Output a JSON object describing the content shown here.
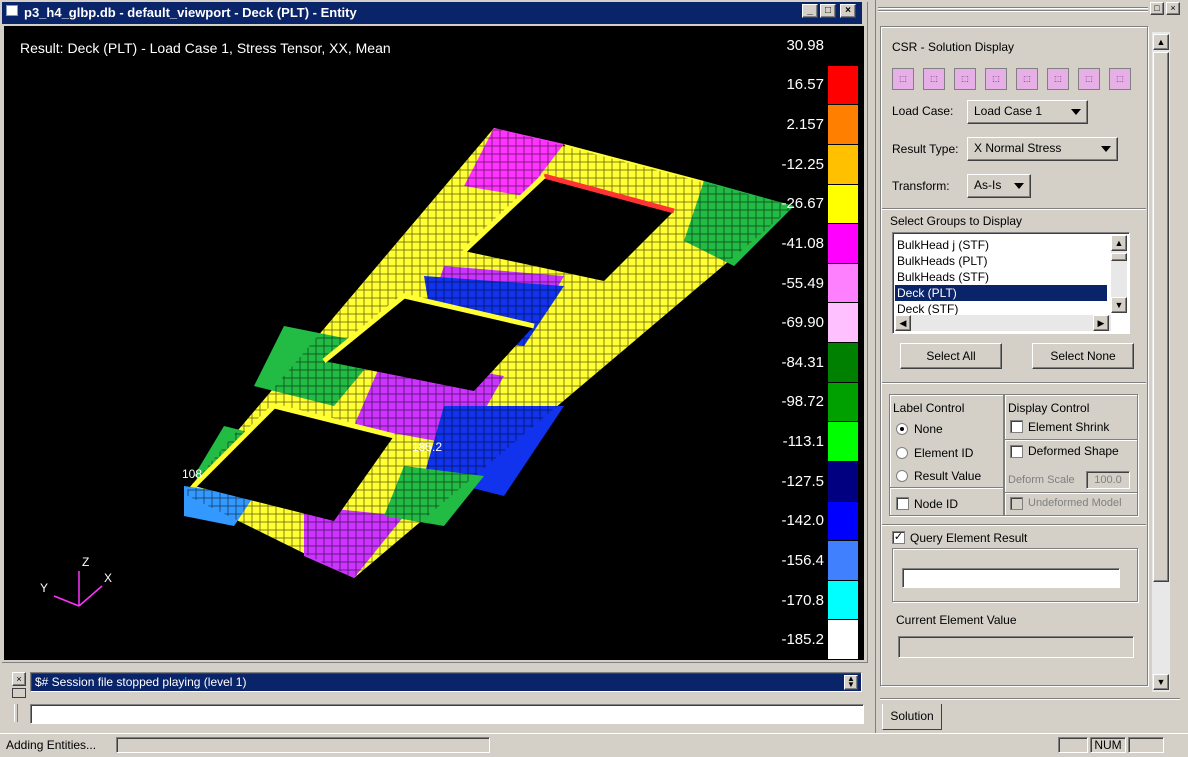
{
  "viewport": {
    "title": "p3_h4_glbp.db - default_viewport - Deck (PLT) - Entity",
    "result_text": "Result: Deck (PLT) - Load Case 1, Stress Tensor, XX, Mean",
    "annot_max": "185.2",
    "annot_min": "108",
    "axis_z": "Z",
    "axis_y": "Y",
    "axis_x": "X",
    "minimize_glyph": "_",
    "maximize_glyph": "□",
    "close_glyph": "×"
  },
  "legend": {
    "labels": [
      "30.98",
      "16.57",
      "2.157",
      "-12.25",
      "-26.67",
      "-41.08",
      "-55.49",
      "-69.90",
      "-84.31",
      "-98.72",
      "-113.1",
      "-127.5",
      "-142.0",
      "-156.4",
      "-170.8",
      "-185.2"
    ],
    "colors": [
      "#000000",
      "#ff0000",
      "#ff8000",
      "#ffc000",
      "#ffff00",
      "#ff00ff",
      "#ff80ff",
      "#ffc0ff",
      "#008000",
      "#00a000",
      "#00ff00",
      "#000080",
      "#0000ff",
      "#4080ff",
      "#00ffff",
      "#ffffff"
    ]
  },
  "panel": {
    "title": "CSR - Solution Display",
    "load_case_label": "Load Case:",
    "load_case_value": "Load Case 1",
    "result_type_label": "Result Type:",
    "result_type_value": "X Normal Stress",
    "transform_label": "Transform:",
    "transform_value": "As-Is",
    "groups_label": "Select Groups to Display",
    "groups": [
      "BulkHead j (STF)",
      "BulkHeads (PLT)",
      "BulkHeads (STF)",
      "Deck (PLT)",
      "Deck (STF)"
    ],
    "selected_group": "Deck (PLT)",
    "select_all": "Select All",
    "select_none": "Select None",
    "label_control": "Label Control",
    "display_control": "Display Control",
    "none": "None",
    "element_id": "Element ID",
    "result_value": "Result Value",
    "node_id": "Node ID",
    "element_shrink": "Element Shrink",
    "deformed_shape": "Deformed Shape",
    "deform_scale": "Deform Scale",
    "deform_scale_value": "100.0",
    "undeformed_model": "Undeformed Model",
    "query_element_result": "Query Element Result",
    "current_element_value": "Current Element Value",
    "tab": "Solution",
    "toolbar_icons": [
      "view-x-icon",
      "view-y-icon",
      "view-z-icon",
      "view-zx-icon",
      "view-iso1-icon",
      "view-iso2-icon",
      "view-iso3-icon",
      "view-iso4-icon"
    ]
  },
  "command": {
    "history": "$# Session file stopped playing (level 1)",
    "input": ""
  },
  "status": {
    "message": "Adding Entities...",
    "num": "NUM"
  }
}
